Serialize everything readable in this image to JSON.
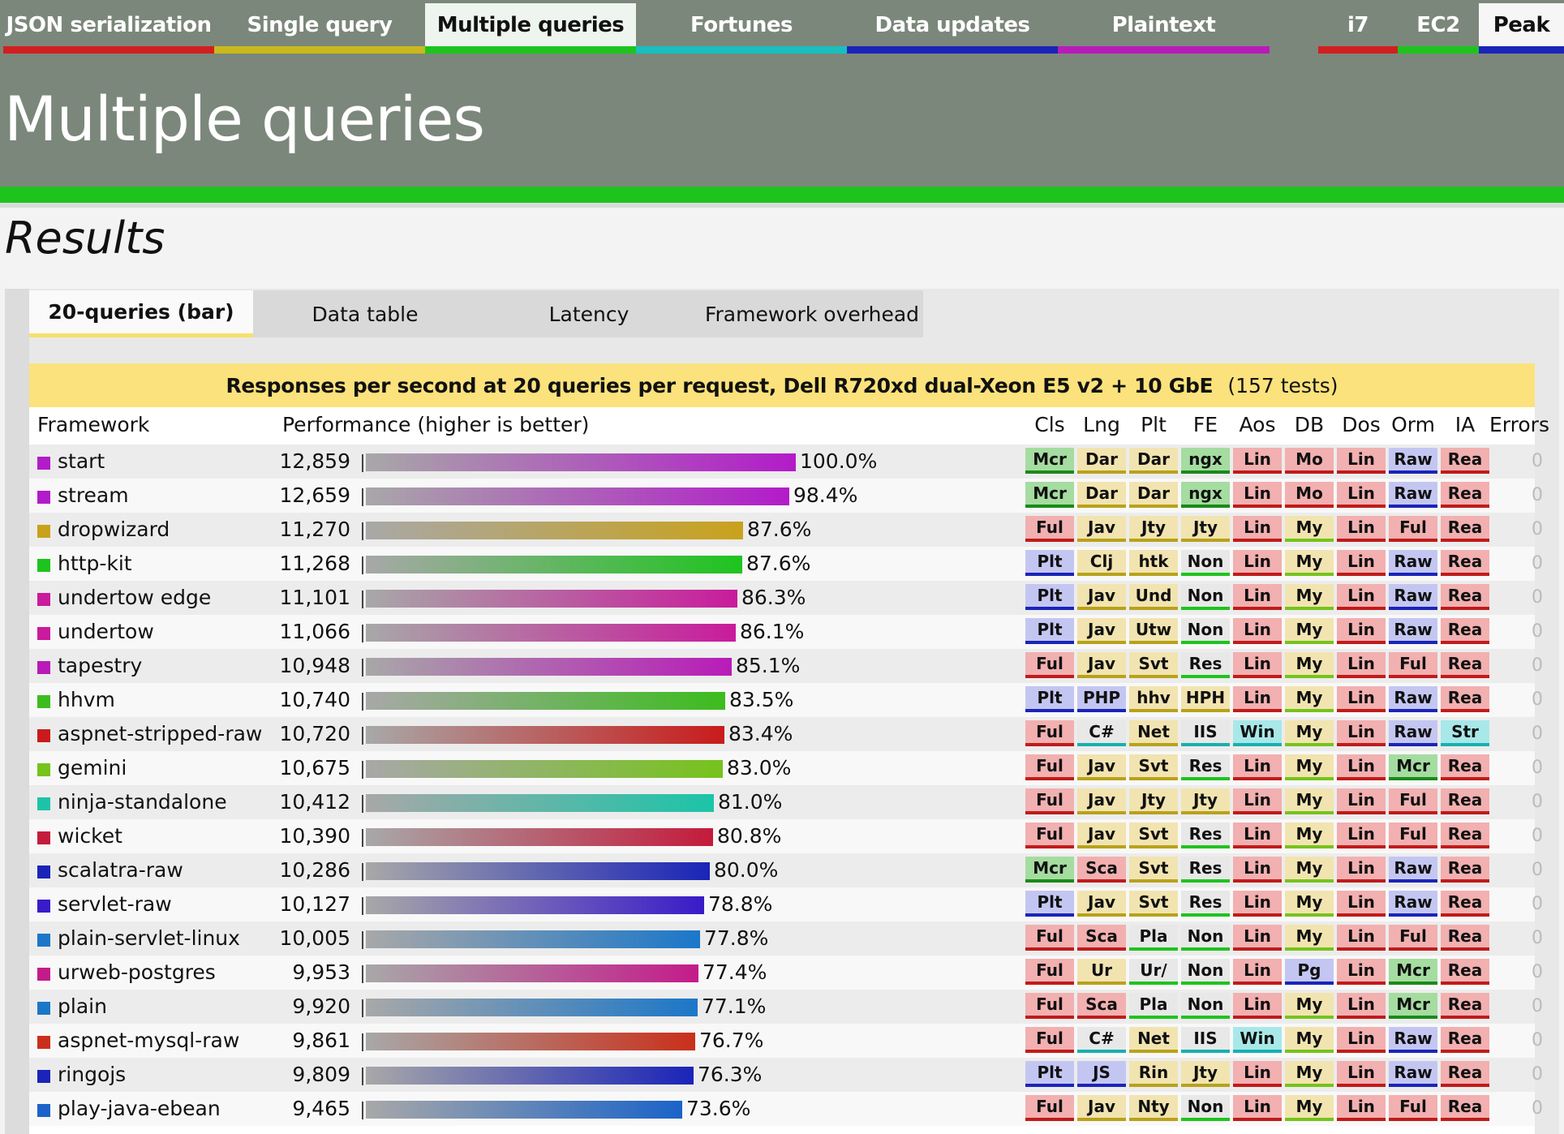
{
  "nav": {
    "tabs": [
      {
        "label": "JSON serialization",
        "color": "#d11f1f"
      },
      {
        "label": "Single query",
        "color": "#c9b91c"
      },
      {
        "label": "Multiple queries",
        "color": "#1ec41e"
      },
      {
        "label": "Fortunes",
        "color": "#18bfbf"
      },
      {
        "label": "Data updates",
        "color": "#1a24b8"
      },
      {
        "label": "Plaintext",
        "color": "#b81bb8"
      }
    ],
    "hardware": [
      {
        "label": "i7",
        "color": "#d11f1f"
      },
      {
        "label": "EC2",
        "color": "#1ec41e"
      },
      {
        "label": "Peak",
        "color": "#1a24b8"
      }
    ]
  },
  "header": {
    "title": "Multiple queries"
  },
  "results": {
    "heading": "Results",
    "subtabs": [
      "20-queries (bar)",
      "Data table",
      "Latency",
      "Framework overhead"
    ]
  },
  "chart": {
    "caption_bold": "Responses per second at 20 queries per request, Dell R720xd dual-Xeon E5 v2 + 10 GbE",
    "caption_count": "(157 tests)",
    "col_framework": "Framework",
    "col_performance": "Performance (higher is better)",
    "col_attrs": [
      "Cls",
      "Lng",
      "Plt",
      "FE",
      "Aos",
      "DB",
      "Dos",
      "Orm",
      "IA"
    ],
    "col_errors": "Errors"
  },
  "chart_data": {
    "type": "bar",
    "title": "Responses per second at 20 queries per request, Dell R720xd dual-Xeon E5 v2 + 10 GbE",
    "ylabel": "Performance (higher is better)",
    "categories": [
      "start",
      "stream",
      "dropwizard",
      "http-kit",
      "undertow edge",
      "undertow",
      "tapestry",
      "hhvm",
      "aspnet-stripped-raw",
      "gemini",
      "ninja-standalone",
      "wicket",
      "scalatra-raw",
      "servlet-raw",
      "plain-servlet-linux",
      "urweb-postgres",
      "plain",
      "aspnet-mysql-raw",
      "ringojs",
      "play-java-ebean"
    ],
    "values": [
      12859,
      12659,
      11270,
      11268,
      11101,
      11066,
      10948,
      10740,
      10720,
      10675,
      10412,
      10390,
      10286,
      10127,
      10005,
      9953,
      9920,
      9861,
      9809,
      9465
    ],
    "value_labels": [
      "12,859",
      "12,659",
      "11,270",
      "11,268",
      "11,101",
      "11,066",
      "10,948",
      "10,740",
      "10,720",
      "10,675",
      "10,412",
      "10,390",
      "10,286",
      "10,127",
      "10,005",
      "9,953",
      "9,920",
      "9,861",
      "9,809",
      "9,465"
    ],
    "percents": [
      "100.0%",
      "98.4%",
      "87.6%",
      "87.6%",
      "86.3%",
      "86.1%",
      "85.1%",
      "83.5%",
      "83.4%",
      "83.0%",
      "81.0%",
      "80.8%",
      "80.0%",
      "78.8%",
      "77.8%",
      "77.4%",
      "77.1%",
      "76.7%",
      "76.3%",
      "73.6%"
    ],
    "colors": [
      "#b21bc9",
      "#b21bc9",
      "#c9a21b",
      "#1ec41e",
      "#c91b9c",
      "#c91b9c",
      "#b81bb8",
      "#3cbc1e",
      "#c91b1b",
      "#76c31b",
      "#1bc4a8",
      "#c41b3c",
      "#1a24b8",
      "#3a1bc9",
      "#1b77c9",
      "#c41b8a",
      "#1b77c9",
      "#c9301b",
      "#1a24b8",
      "#1b63c9"
    ],
    "errors": [
      0,
      0,
      0,
      0,
      0,
      0,
      0,
      0,
      0,
      0,
      0,
      0,
      0,
      0,
      0,
      0,
      0,
      0,
      0,
      0
    ],
    "attrs": [
      [
        "Mcr",
        "Dar",
        "Dar",
        "ngx",
        "Lin",
        "Mo",
        "Lin",
        "Raw",
        "Rea"
      ],
      [
        "Mcr",
        "Dar",
        "Dar",
        "ngx",
        "Lin",
        "Mo",
        "Lin",
        "Raw",
        "Rea"
      ],
      [
        "Ful",
        "Jav",
        "Jty",
        "Jty",
        "Lin",
        "My",
        "Lin",
        "Ful",
        "Rea"
      ],
      [
        "Plt",
        "Clj",
        "htk",
        "Non",
        "Lin",
        "My",
        "Lin",
        "Raw",
        "Rea"
      ],
      [
        "Plt",
        "Jav",
        "Und",
        "Non",
        "Lin",
        "My",
        "Lin",
        "Raw",
        "Rea"
      ],
      [
        "Plt",
        "Jav",
        "Utw",
        "Non",
        "Lin",
        "My",
        "Lin",
        "Raw",
        "Rea"
      ],
      [
        "Ful",
        "Jav",
        "Svt",
        "Res",
        "Lin",
        "My",
        "Lin",
        "Ful",
        "Rea"
      ],
      [
        "Plt",
        "PHP",
        "hhv",
        "HPH",
        "Lin",
        "My",
        "Lin",
        "Raw",
        "Rea"
      ],
      [
        "Ful",
        "C#",
        "Net",
        "IIS",
        "Win",
        "My",
        "Lin",
        "Raw",
        "Str"
      ],
      [
        "Ful",
        "Jav",
        "Svt",
        "Res",
        "Lin",
        "My",
        "Lin",
        "Mcr",
        "Rea"
      ],
      [
        "Ful",
        "Jav",
        "Jty",
        "Jty",
        "Lin",
        "My",
        "Lin",
        "Ful",
        "Rea"
      ],
      [
        "Ful",
        "Jav",
        "Svt",
        "Res",
        "Lin",
        "My",
        "Lin",
        "Ful",
        "Rea"
      ],
      [
        "Mcr",
        "Sca",
        "Svt",
        "Res",
        "Lin",
        "My",
        "Lin",
        "Raw",
        "Rea"
      ],
      [
        "Plt",
        "Jav",
        "Svt",
        "Res",
        "Lin",
        "My",
        "Lin",
        "Raw",
        "Rea"
      ],
      [
        "Ful",
        "Sca",
        "Pla",
        "Non",
        "Lin",
        "My",
        "Lin",
        "Ful",
        "Rea"
      ],
      [
        "Ful",
        "Ur",
        "Ur/",
        "Non",
        "Lin",
        "Pg",
        "Lin",
        "Mcr",
        "Rea"
      ],
      [
        "Ful",
        "Sca",
        "Pla",
        "Non",
        "Lin",
        "My",
        "Lin",
        "Mcr",
        "Rea"
      ],
      [
        "Ful",
        "C#",
        "Net",
        "IIS",
        "Win",
        "My",
        "Lin",
        "Raw",
        "Rea"
      ],
      [
        "Plt",
        "JS",
        "Rin",
        "Jty",
        "Lin",
        "My",
        "Lin",
        "Raw",
        "Rea"
      ],
      [
        "Ful",
        "Jav",
        "Nty",
        "Non",
        "Lin",
        "My",
        "Lin",
        "Ful",
        "Rea"
      ]
    ]
  }
}
